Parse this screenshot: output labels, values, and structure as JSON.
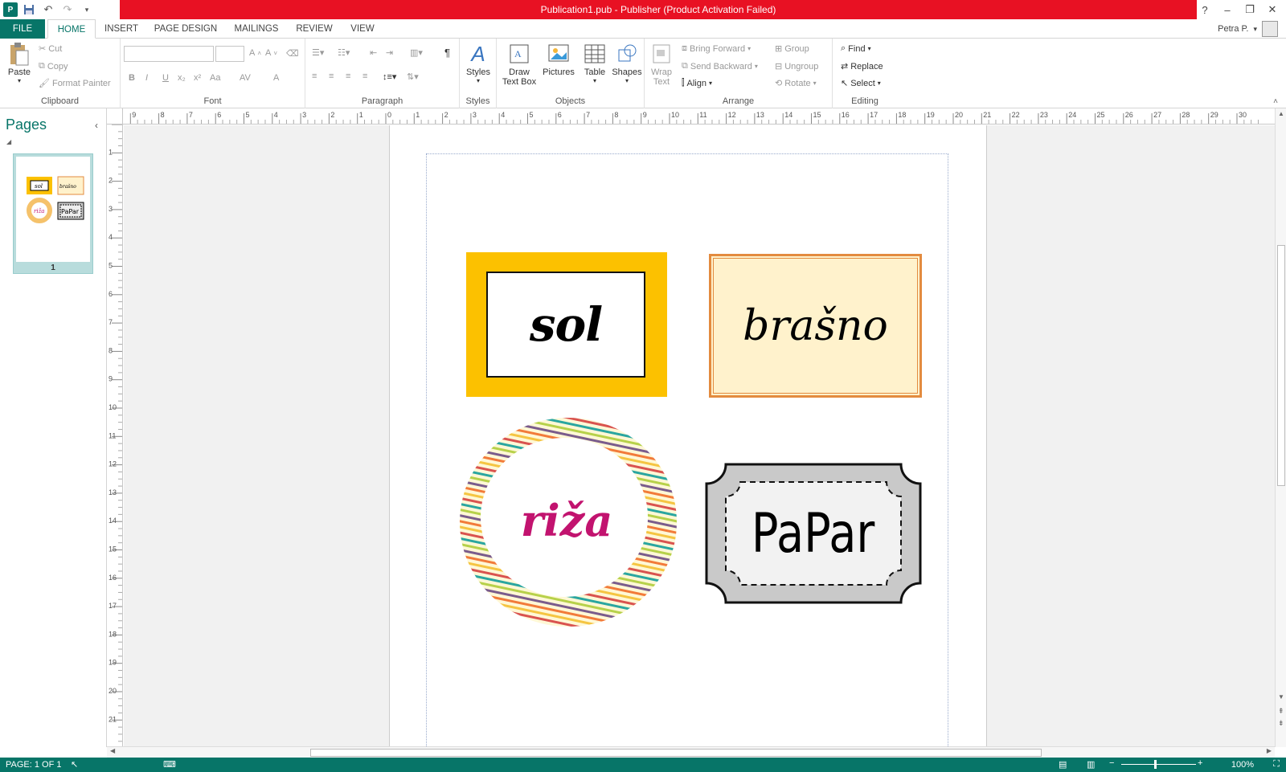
{
  "app": {
    "title": "Publication1.pub -  Publisher (Product Activation Failed)",
    "icon": "publisher-icon"
  },
  "window_controls": [
    "?",
    "–",
    "❐",
    "✕"
  ],
  "quick_access": [
    "save-icon",
    "undo-icon",
    "redo-icon",
    "customize-icon"
  ],
  "tabs": {
    "file": "FILE",
    "home": "HOME",
    "insert": "INSERT",
    "page_design": "PAGE DESIGN",
    "mailings": "MAILINGS",
    "review": "REVIEW",
    "view": "VIEW"
  },
  "user": {
    "name": "Petra P."
  },
  "ribbon": {
    "clipboard": {
      "label": "Clipboard",
      "paste": "Paste",
      "cut": "Cut",
      "copy": "Copy",
      "format_painter": "Format Painter"
    },
    "font": {
      "label": "Font",
      "bold": "B",
      "italic": "I",
      "underline": "U",
      "subscript": "x₂",
      "superscript": "x²",
      "change_case": "Aa",
      "char_spacing": "AV",
      "font_color": "A",
      "grow": "A",
      "shrink": "A"
    },
    "paragraph": {
      "label": "Paragraph",
      "pilcrow": "¶"
    },
    "styles": {
      "label": "Styles",
      "styles": "Styles"
    },
    "objects": {
      "label": "Objects",
      "draw_text_box_1": "Draw",
      "draw_text_box_2": "Text Box",
      "pictures": "Pictures",
      "table": "Table",
      "shapes": "Shapes"
    },
    "arrange": {
      "label": "Arrange",
      "wrap_1": "Wrap",
      "wrap_2": "Text",
      "bring_forward": "Bring Forward",
      "send_backward": "Send Backward",
      "align": "Align",
      "group": "Group",
      "ungroup": "Ungroup",
      "rotate": "Rotate"
    },
    "editing": {
      "label": "Editing",
      "find": "Find",
      "replace": "Replace",
      "select": "Select"
    }
  },
  "pages_pane": {
    "title": "Pages",
    "page_number": "1"
  },
  "labels": {
    "sol": "sol",
    "brasno": "brašno",
    "riza": "riža",
    "papar": "PaPar"
  },
  "colors": {
    "accent": "#077568",
    "title_bar": "#e81123",
    "sol_frame": "#fcc100",
    "brasno_fill": "#fff2cc",
    "brasno_border": "#e38b3f",
    "riza_text": "#c2136f"
  },
  "status": {
    "page": "PAGE: 1 OF 1",
    "zoom": "100%"
  }
}
